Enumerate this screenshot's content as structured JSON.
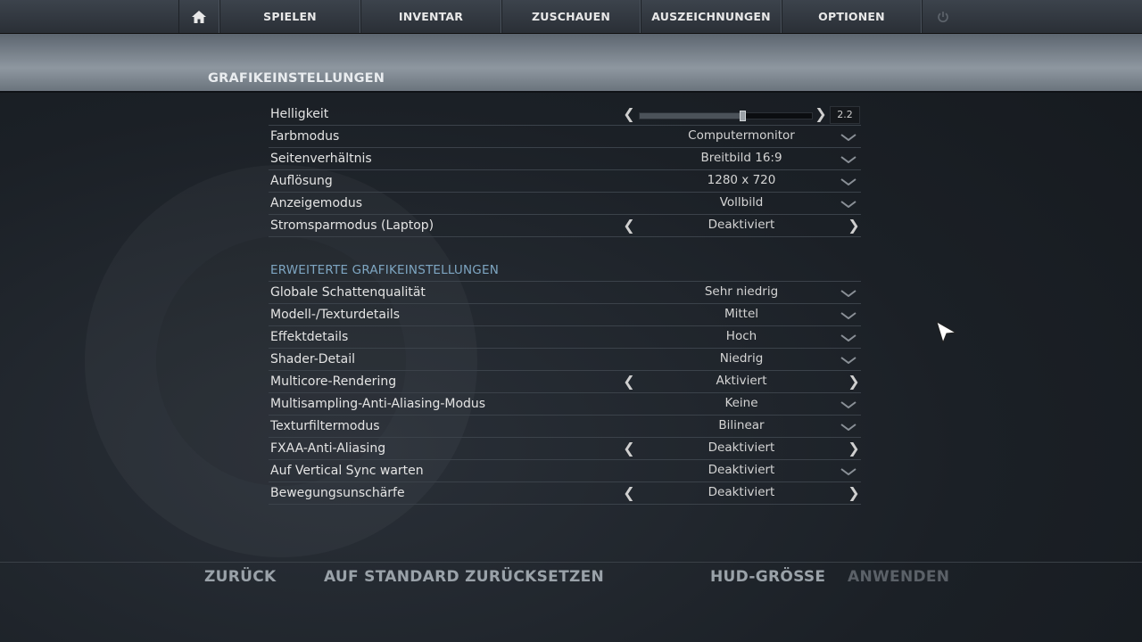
{
  "nav": {
    "items": [
      "SPIELEN",
      "INVENTAR",
      "ZUSCHAUEN",
      "AUSZEICHNUNGEN",
      "OPTIONEN"
    ]
  },
  "page_title": "GRAFIKEINSTELLUNGEN",
  "settings": [
    {
      "label": "Helligkeit",
      "value": "2.2",
      "control": "slider",
      "level": 0.6
    },
    {
      "label": "Farbmodus",
      "value": "Computermonitor",
      "control": "dropdown"
    },
    {
      "label": "Seitenverhältnis",
      "value": "Breitbild 16:9",
      "control": "dropdown"
    },
    {
      "label": "Auflösung",
      "value": "1280 x 720",
      "control": "dropdown"
    },
    {
      "label": "Anzeigemodus",
      "value": "Vollbild",
      "control": "dropdown"
    },
    {
      "label": "Stromsparmodus (Laptop)",
      "value": "Deaktiviert",
      "control": "toggle"
    }
  ],
  "advanced_title": "ERWEITERTE GRAFIKEINSTELLUNGEN",
  "advanced": [
    {
      "label": "Globale Schattenqualität",
      "value": "Sehr niedrig",
      "control": "dropdown"
    },
    {
      "label": "Modell-/Texturdetails",
      "value": "Mittel",
      "control": "dropdown"
    },
    {
      "label": "Effektdetails",
      "value": "Hoch",
      "control": "dropdown"
    },
    {
      "label": "Shader-Detail",
      "value": "Niedrig",
      "control": "dropdown"
    },
    {
      "label": "Multicore-Rendering",
      "value": "Aktiviert",
      "control": "toggle"
    },
    {
      "label": "Multisampling-Anti-Aliasing-Modus",
      "value": "Keine",
      "control": "dropdown"
    },
    {
      "label": "Texturfiltermodus",
      "value": "Bilinear",
      "control": "dropdown"
    },
    {
      "label": "FXAA-Anti-Aliasing",
      "value": "Deaktiviert",
      "control": "toggle"
    },
    {
      "label": "Auf Vertical Sync warten",
      "value": "Deaktiviert",
      "control": "dropdown"
    },
    {
      "label": "Bewegungsunschärfe",
      "value": "Deaktiviert",
      "control": "toggle"
    }
  ],
  "footer": {
    "back": "ZURÜCK",
    "reset": "AUF STANDARD ZURÜCKSETZEN",
    "hud": "HUD-GRÖSSE",
    "apply": "ANWENDEN"
  },
  "colors": {
    "accent_section": "#7ea6c2",
    "background": "#1b2026"
  }
}
